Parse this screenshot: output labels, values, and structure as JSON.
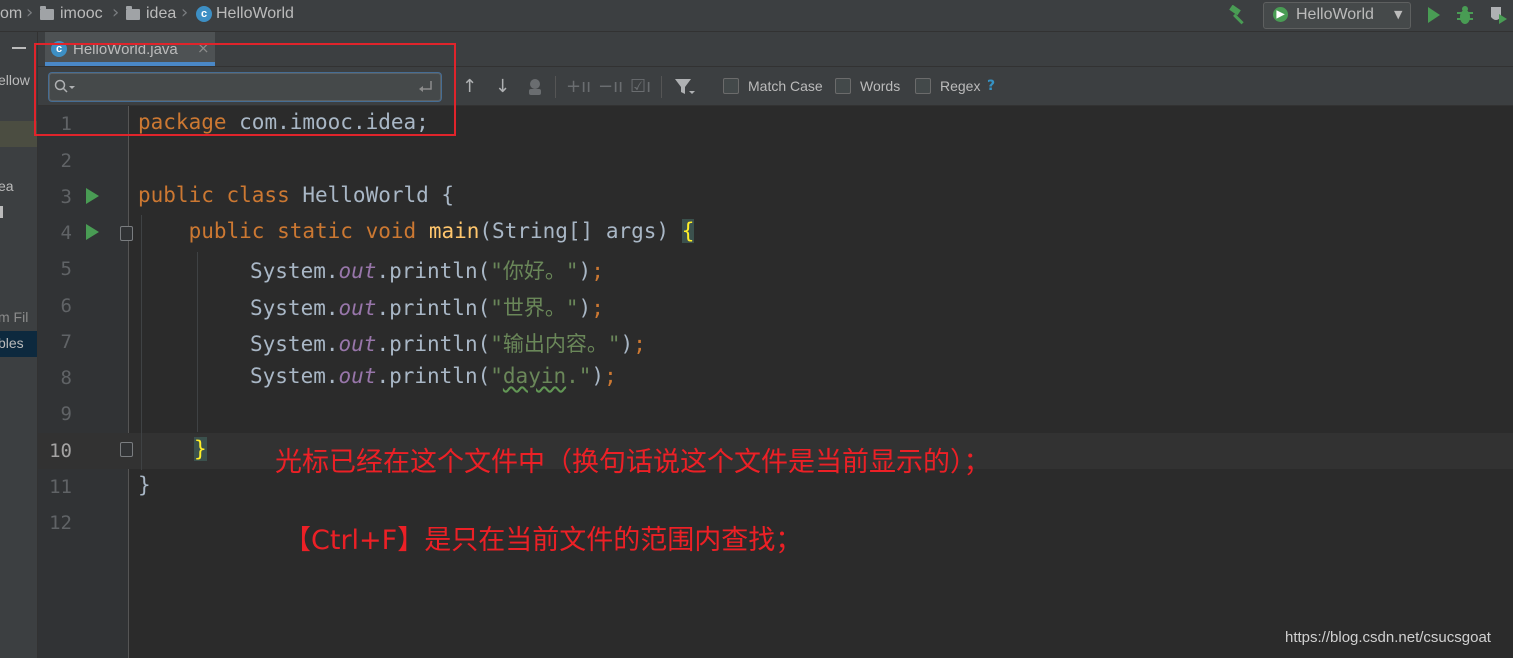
{
  "breadcrumb": {
    "items": [
      "om",
      "imooc",
      "idea",
      "HelloWorld"
    ]
  },
  "toolbar": {
    "run_config": "HelloWorld"
  },
  "left_panel": {
    "labels": [
      "ellow",
      "ea",
      "m Fil",
      "bles"
    ]
  },
  "editor_tab": {
    "filename": "HelloWorld.java",
    "close_glyph": "×"
  },
  "find_bar": {
    "search_value": "",
    "match_case_label": "Match Case",
    "words_label": "Words",
    "regex_label": "Regex",
    "help_label": "?"
  },
  "editor": {
    "line_numbers": [
      "1",
      "2",
      "3",
      "4",
      "5",
      "6",
      "7",
      "8",
      "9",
      "10",
      "11",
      "12"
    ],
    "current_line": "10",
    "code": {
      "l1_kw": "package",
      "l1_rest": " com.imooc.idea;",
      "l3_kw": "public class",
      "l3_rest": " HelloWorld {",
      "l4_indent": "    ",
      "l4_kw": "public static void",
      "l4_sp": " ",
      "l4_fn": "main",
      "l4_rest": "(String[] args) ",
      "l4_brace": "{",
      "sys": "System.",
      "out": "out",
      "println_open": ".println(",
      "str5": "\"你好。\"",
      "str6": "\"世界。\"",
      "str7": "\"输出内容。\"",
      "str8_q1": "\"",
      "str8_word": "dayin",
      "str8_q2": ".\"",
      "close_paren": ")",
      "semicolon": ";",
      "l10_brace": "}",
      "l11_brace": "}"
    }
  },
  "annotations": {
    "note1": "光标已经在这个文件中（换句话说这个文件是当前显示的）；",
    "note2": "【Ctrl+F】是只在当前文件的范围内查找；"
  },
  "watermark": "https://blog.csdn.net/csucsgoat",
  "colors": {
    "keyword": "#cc7832",
    "string": "#6a8759",
    "field": "#9876aa",
    "function": "#ffc66d",
    "annotation_red": "#e0242b",
    "run_green": "#499c54"
  }
}
